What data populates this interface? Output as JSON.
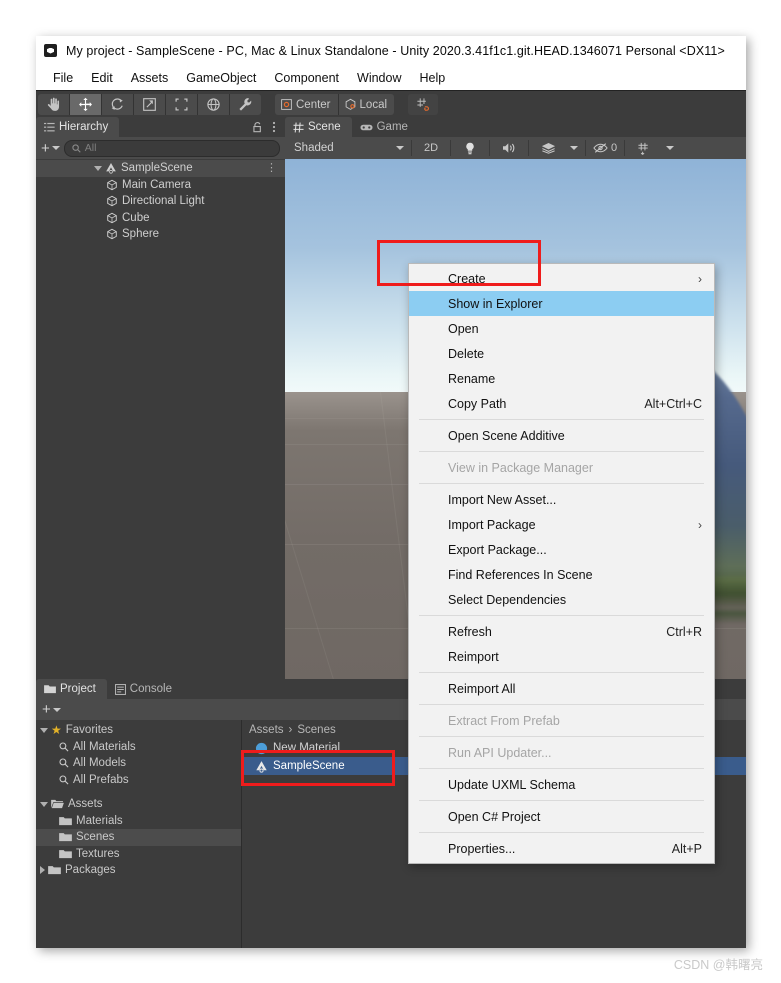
{
  "window": {
    "title": "My project - SampleScene - PC, Mac & Linux Standalone - Unity 2020.3.41f1c1.git.HEAD.1346071 Personal <DX11>",
    "app_icon": "unity-logo-icon"
  },
  "menubar": {
    "items": [
      {
        "label": "File"
      },
      {
        "label": "Edit"
      },
      {
        "label": "Assets"
      },
      {
        "label": "GameObject"
      },
      {
        "label": "Component"
      },
      {
        "label": "Window"
      },
      {
        "label": "Help"
      }
    ]
  },
  "toolbar": {
    "tools": [
      {
        "name": "hand-tool-icon",
        "active": false
      },
      {
        "name": "move-tool-icon",
        "active": true
      },
      {
        "name": "rotate-tool-icon",
        "active": false
      },
      {
        "name": "scale-tool-icon",
        "active": false
      },
      {
        "name": "rect-transform-tool-icon",
        "active": false
      },
      {
        "name": "transform-tool-icon",
        "active": false
      },
      {
        "name": "custom-editor-tool-icon",
        "active": false
      }
    ],
    "pivot_mode": "Center",
    "pivot_rotation": "Local",
    "snap_tool": "grid-snapping-icon"
  },
  "hierarchy": {
    "tab_label": "Hierarchy",
    "tab_icon": "hierarchy-icon",
    "lock_icon": "lock-icon",
    "more_icon": "kebab-menu-icon",
    "add_label": "+",
    "search_placeholder": "All",
    "tree": [
      {
        "label": "SampleScene",
        "depth": 0,
        "icon": "scene-icon",
        "selected": true,
        "expanded": true
      },
      {
        "label": "Main Camera",
        "depth": 1,
        "icon": "gameobject-icon",
        "selected": false
      },
      {
        "label": "Directional Light",
        "depth": 1,
        "icon": "gameobject-icon",
        "selected": false
      },
      {
        "label": "Cube",
        "depth": 1,
        "icon": "gameobject-icon",
        "selected": false
      },
      {
        "label": "Sphere",
        "depth": 1,
        "icon": "gameobject-icon",
        "selected": false
      }
    ]
  },
  "sceneview": {
    "tabs": [
      {
        "label": "Scene",
        "icon": "scene-grid-icon",
        "active": true
      },
      {
        "label": "Game",
        "icon": "gamepad-icon",
        "active": false
      }
    ],
    "draw_mode": "Shaded",
    "two_d_label": "2D",
    "lighting_icon": "lightbulb-icon",
    "audio_icon": "speaker-icon",
    "effects_icon": "effects-icon",
    "hidden_objects_icon": "eye-off-icon",
    "hidden_objects_count": "0",
    "grid_icon": "grid-visibility-icon"
  },
  "context_menu": {
    "items": [
      {
        "label": "Create",
        "shortcut": "",
        "submenu": true,
        "disabled": false,
        "highlighted": false
      },
      {
        "label": "Show in Explorer",
        "shortcut": "",
        "submenu": false,
        "disabled": false,
        "highlighted": true
      },
      {
        "label": "Open",
        "shortcut": "",
        "submenu": false,
        "disabled": false,
        "highlighted": false
      },
      {
        "label": "Delete",
        "shortcut": "",
        "submenu": false,
        "disabled": false,
        "highlighted": false
      },
      {
        "label": "Rename",
        "shortcut": "",
        "submenu": false,
        "disabled": false,
        "highlighted": false
      },
      {
        "label": "Copy Path",
        "shortcut": "Alt+Ctrl+C",
        "submenu": false,
        "disabled": false,
        "highlighted": false
      },
      {
        "separator": true
      },
      {
        "label": "Open Scene Additive",
        "shortcut": "",
        "submenu": false,
        "disabled": false,
        "highlighted": false
      },
      {
        "separator": true
      },
      {
        "label": "View in Package Manager",
        "shortcut": "",
        "submenu": false,
        "disabled": true,
        "highlighted": false
      },
      {
        "separator": true
      },
      {
        "label": "Import New Asset...",
        "shortcut": "",
        "submenu": false,
        "disabled": false,
        "highlighted": false
      },
      {
        "label": "Import Package",
        "shortcut": "",
        "submenu": true,
        "disabled": false,
        "highlighted": false
      },
      {
        "label": "Export Package...",
        "shortcut": "",
        "submenu": false,
        "disabled": false,
        "highlighted": false
      },
      {
        "label": "Find References In Scene",
        "shortcut": "",
        "submenu": false,
        "disabled": false,
        "highlighted": false
      },
      {
        "label": "Select Dependencies",
        "shortcut": "",
        "submenu": false,
        "disabled": false,
        "highlighted": false
      },
      {
        "separator": true
      },
      {
        "label": "Refresh",
        "shortcut": "Ctrl+R",
        "submenu": false,
        "disabled": false,
        "highlighted": false
      },
      {
        "label": "Reimport",
        "shortcut": "",
        "submenu": false,
        "disabled": false,
        "highlighted": false
      },
      {
        "separator": true
      },
      {
        "label": "Reimport All",
        "shortcut": "",
        "submenu": false,
        "disabled": false,
        "highlighted": false
      },
      {
        "separator": true
      },
      {
        "label": "Extract From Prefab",
        "shortcut": "",
        "submenu": false,
        "disabled": true,
        "highlighted": false
      },
      {
        "separator": true
      },
      {
        "label": "Run API Updater...",
        "shortcut": "",
        "submenu": false,
        "disabled": true,
        "highlighted": false
      },
      {
        "separator": true
      },
      {
        "label": "Update UXML Schema",
        "shortcut": "",
        "submenu": false,
        "disabled": false,
        "highlighted": false
      },
      {
        "separator": true
      },
      {
        "label": "Open C# Project",
        "shortcut": "",
        "submenu": false,
        "disabled": false,
        "highlighted": false
      },
      {
        "separator": true
      },
      {
        "label": "Properties...",
        "shortcut": "Alt+P",
        "submenu": false,
        "disabled": false,
        "highlighted": false
      }
    ]
  },
  "project": {
    "tabs": [
      {
        "label": "Project",
        "icon": "folder-icon",
        "active": true
      },
      {
        "label": "Console",
        "icon": "console-icon",
        "active": false
      }
    ],
    "add_label": "+",
    "tree": [
      {
        "label": "Favorites",
        "depth": 0,
        "icon": "star-icon",
        "expanded": true,
        "selected": false
      },
      {
        "label": "All Materials",
        "depth": 1,
        "icon": "search-icon",
        "selected": false
      },
      {
        "label": "All Models",
        "depth": 1,
        "icon": "search-icon",
        "selected": false
      },
      {
        "label": "All Prefabs",
        "depth": 1,
        "icon": "search-icon",
        "selected": false
      },
      {
        "label": "Assets",
        "depth": 0,
        "icon": "folder-open-icon",
        "expanded": true,
        "selected": false
      },
      {
        "label": "Materials",
        "depth": 1,
        "icon": "folder-icon",
        "selected": false
      },
      {
        "label": "Scenes",
        "depth": 1,
        "icon": "folder-icon",
        "selected": true
      },
      {
        "label": "Textures",
        "depth": 1,
        "icon": "folder-icon",
        "selected": false
      },
      {
        "label": "Packages",
        "depth": 0,
        "icon": "folder-icon",
        "expanded": false,
        "selected": false
      }
    ],
    "breadcrumb": [
      "Assets",
      "Scenes"
    ],
    "breadcrumb_sep": "›",
    "assets": [
      {
        "label": "New Material",
        "icon": "material-sphere-icon",
        "selected": false
      },
      {
        "label": "SampleScene",
        "icon": "unity-scene-icon",
        "selected": true
      }
    ]
  },
  "annotations": {
    "highlight_color": "#ef1c1c",
    "boxes": [
      "show-in-explorer-menu-item",
      "samplescene-asset-row"
    ]
  },
  "watermark": {
    "text": "CSDN @韩曙亮"
  }
}
